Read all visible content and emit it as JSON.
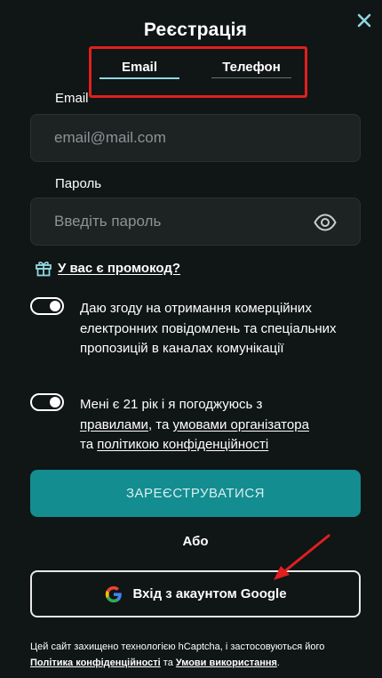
{
  "header": {
    "title": "Реєстрація"
  },
  "tabs": [
    {
      "label": "Email",
      "active": true
    },
    {
      "label": "Телефон",
      "active": false
    }
  ],
  "email": {
    "label": "Email",
    "placeholder": "email@mail.com",
    "value": ""
  },
  "password": {
    "label": "Пароль",
    "placeholder": "Введіть пароль",
    "value": ""
  },
  "promo": {
    "label": "У вас є промокод?"
  },
  "consents": [
    {
      "checked": true,
      "text": "Даю згоду на отримання комерційних електронних повідомлень та спеціальних пропозицій в каналах комунікації"
    },
    {
      "checked": true,
      "text_1": "Мені є 21 рік і я погоджуюсь з",
      "link_rules": "правилами",
      "text_2": ", та",
      "link_terms": "умовами організатора",
      "text_3": "та",
      "link_privacy": "політикою конфіденційності"
    }
  ],
  "register_button": "ЗАРЕЄСТРУВАТИСЯ",
  "or_text": "Або",
  "google_button": "Вхід з акаунтом Google",
  "footer": {
    "text_1": "Цей сайт захищено технологією hCaptcha, і застосовуються його",
    "link_privacy": "Політика конфіденційності",
    "text_2": "та",
    "link_terms": "Умови використання",
    "text_3": "."
  },
  "colors": {
    "background": "#101516",
    "field_background": "#1d2223",
    "accent": "#138d90",
    "tab_underline": "#8fd8df",
    "annotation": "#e01f1f"
  }
}
